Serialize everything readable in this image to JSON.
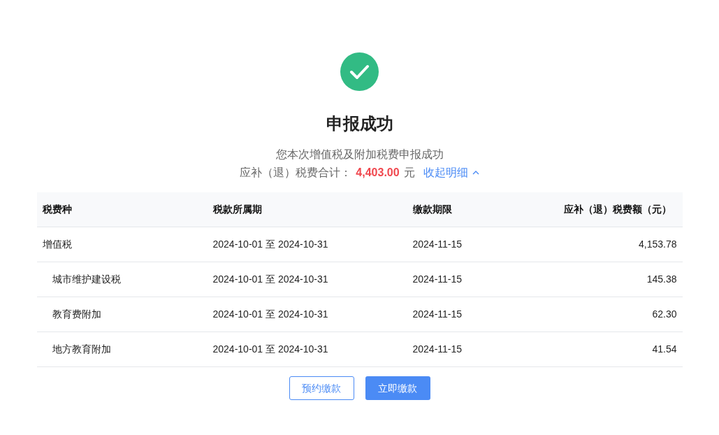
{
  "result": {
    "title": "申报成功",
    "message": "您本次增值税及附加税费申报成功",
    "total_label": "应补（退）税费合计：",
    "total_amount": "4,403.00",
    "total_unit": "元",
    "toggle": {
      "label": "收起明细",
      "expanded": true
    }
  },
  "table": {
    "columns": [
      "税费种",
      "税款所属期",
      "缴款期限",
      "应补（退）税费额（元）"
    ],
    "rows": [
      {
        "cells": [
          "增值税",
          "2024-10-01 至 2024-10-31",
          "2024-11-15",
          "4,153.78"
        ],
        "children": [
          {
            "cells": [
              "城市维护建设税",
              "2024-10-01 至 2024-10-31",
              "2024-11-15",
              "145.38"
            ]
          },
          {
            "cells": [
              "教育费附加",
              "2024-10-01 至 2024-10-31",
              "2024-11-15",
              "62.30"
            ]
          },
          {
            "cells": [
              "地方教育附加",
              "2024-10-01 至 2024-10-31",
              "2024-11-15",
              "41.54"
            ]
          }
        ]
      }
    ]
  },
  "buttons": [
    {
      "label": "预约缴款",
      "kind": "default"
    },
    {
      "label": "立即缴款",
      "kind": "primary"
    }
  ]
}
